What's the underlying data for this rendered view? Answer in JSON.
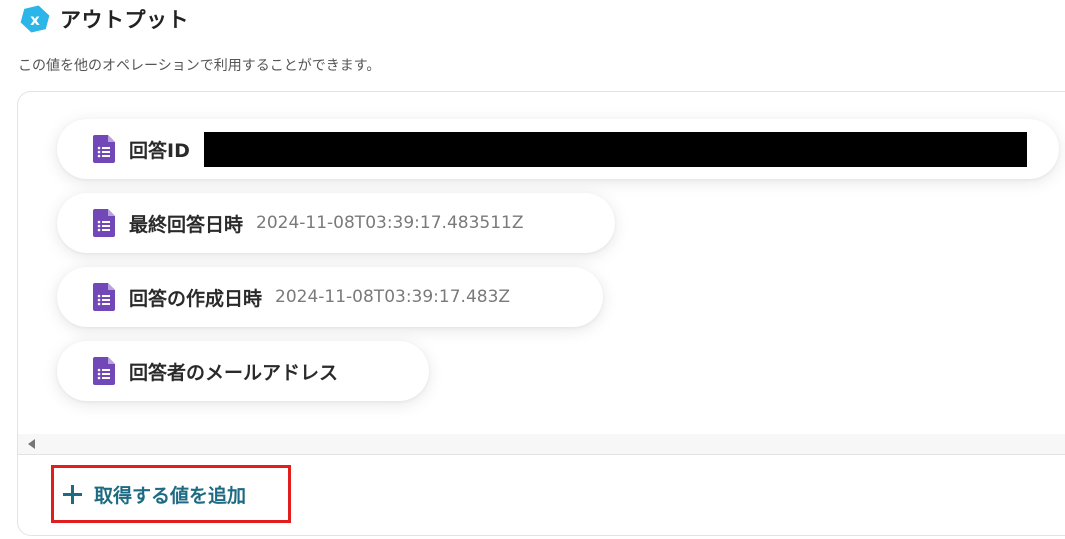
{
  "header": {
    "title": "アウトプット",
    "description": "この値を他のオペレーションで利用することができます。",
    "logo_icon": "x-hexagon-logo-icon"
  },
  "outputs": [
    {
      "label": "回答ID",
      "value": "",
      "redacted": true,
      "icon": "google-forms-icon"
    },
    {
      "label": "最終回答日時",
      "value": "2024-11-08T03:39:17.483511Z",
      "icon": "google-forms-icon"
    },
    {
      "label": "回答の作成日時",
      "value": "2024-11-08T03:39:17.483Z",
      "icon": "google-forms-icon"
    },
    {
      "label": "回答者のメールアドレス",
      "value": "",
      "icon": "google-forms-icon"
    }
  ],
  "add_button": {
    "label": "取得する値を追加",
    "icon": "plus-icon",
    "highlight_color": "#e11d1d"
  },
  "colors": {
    "accent": "#1d6b82",
    "forms_purple": "#7248b9",
    "logo_blue": "#2bb5e8"
  }
}
